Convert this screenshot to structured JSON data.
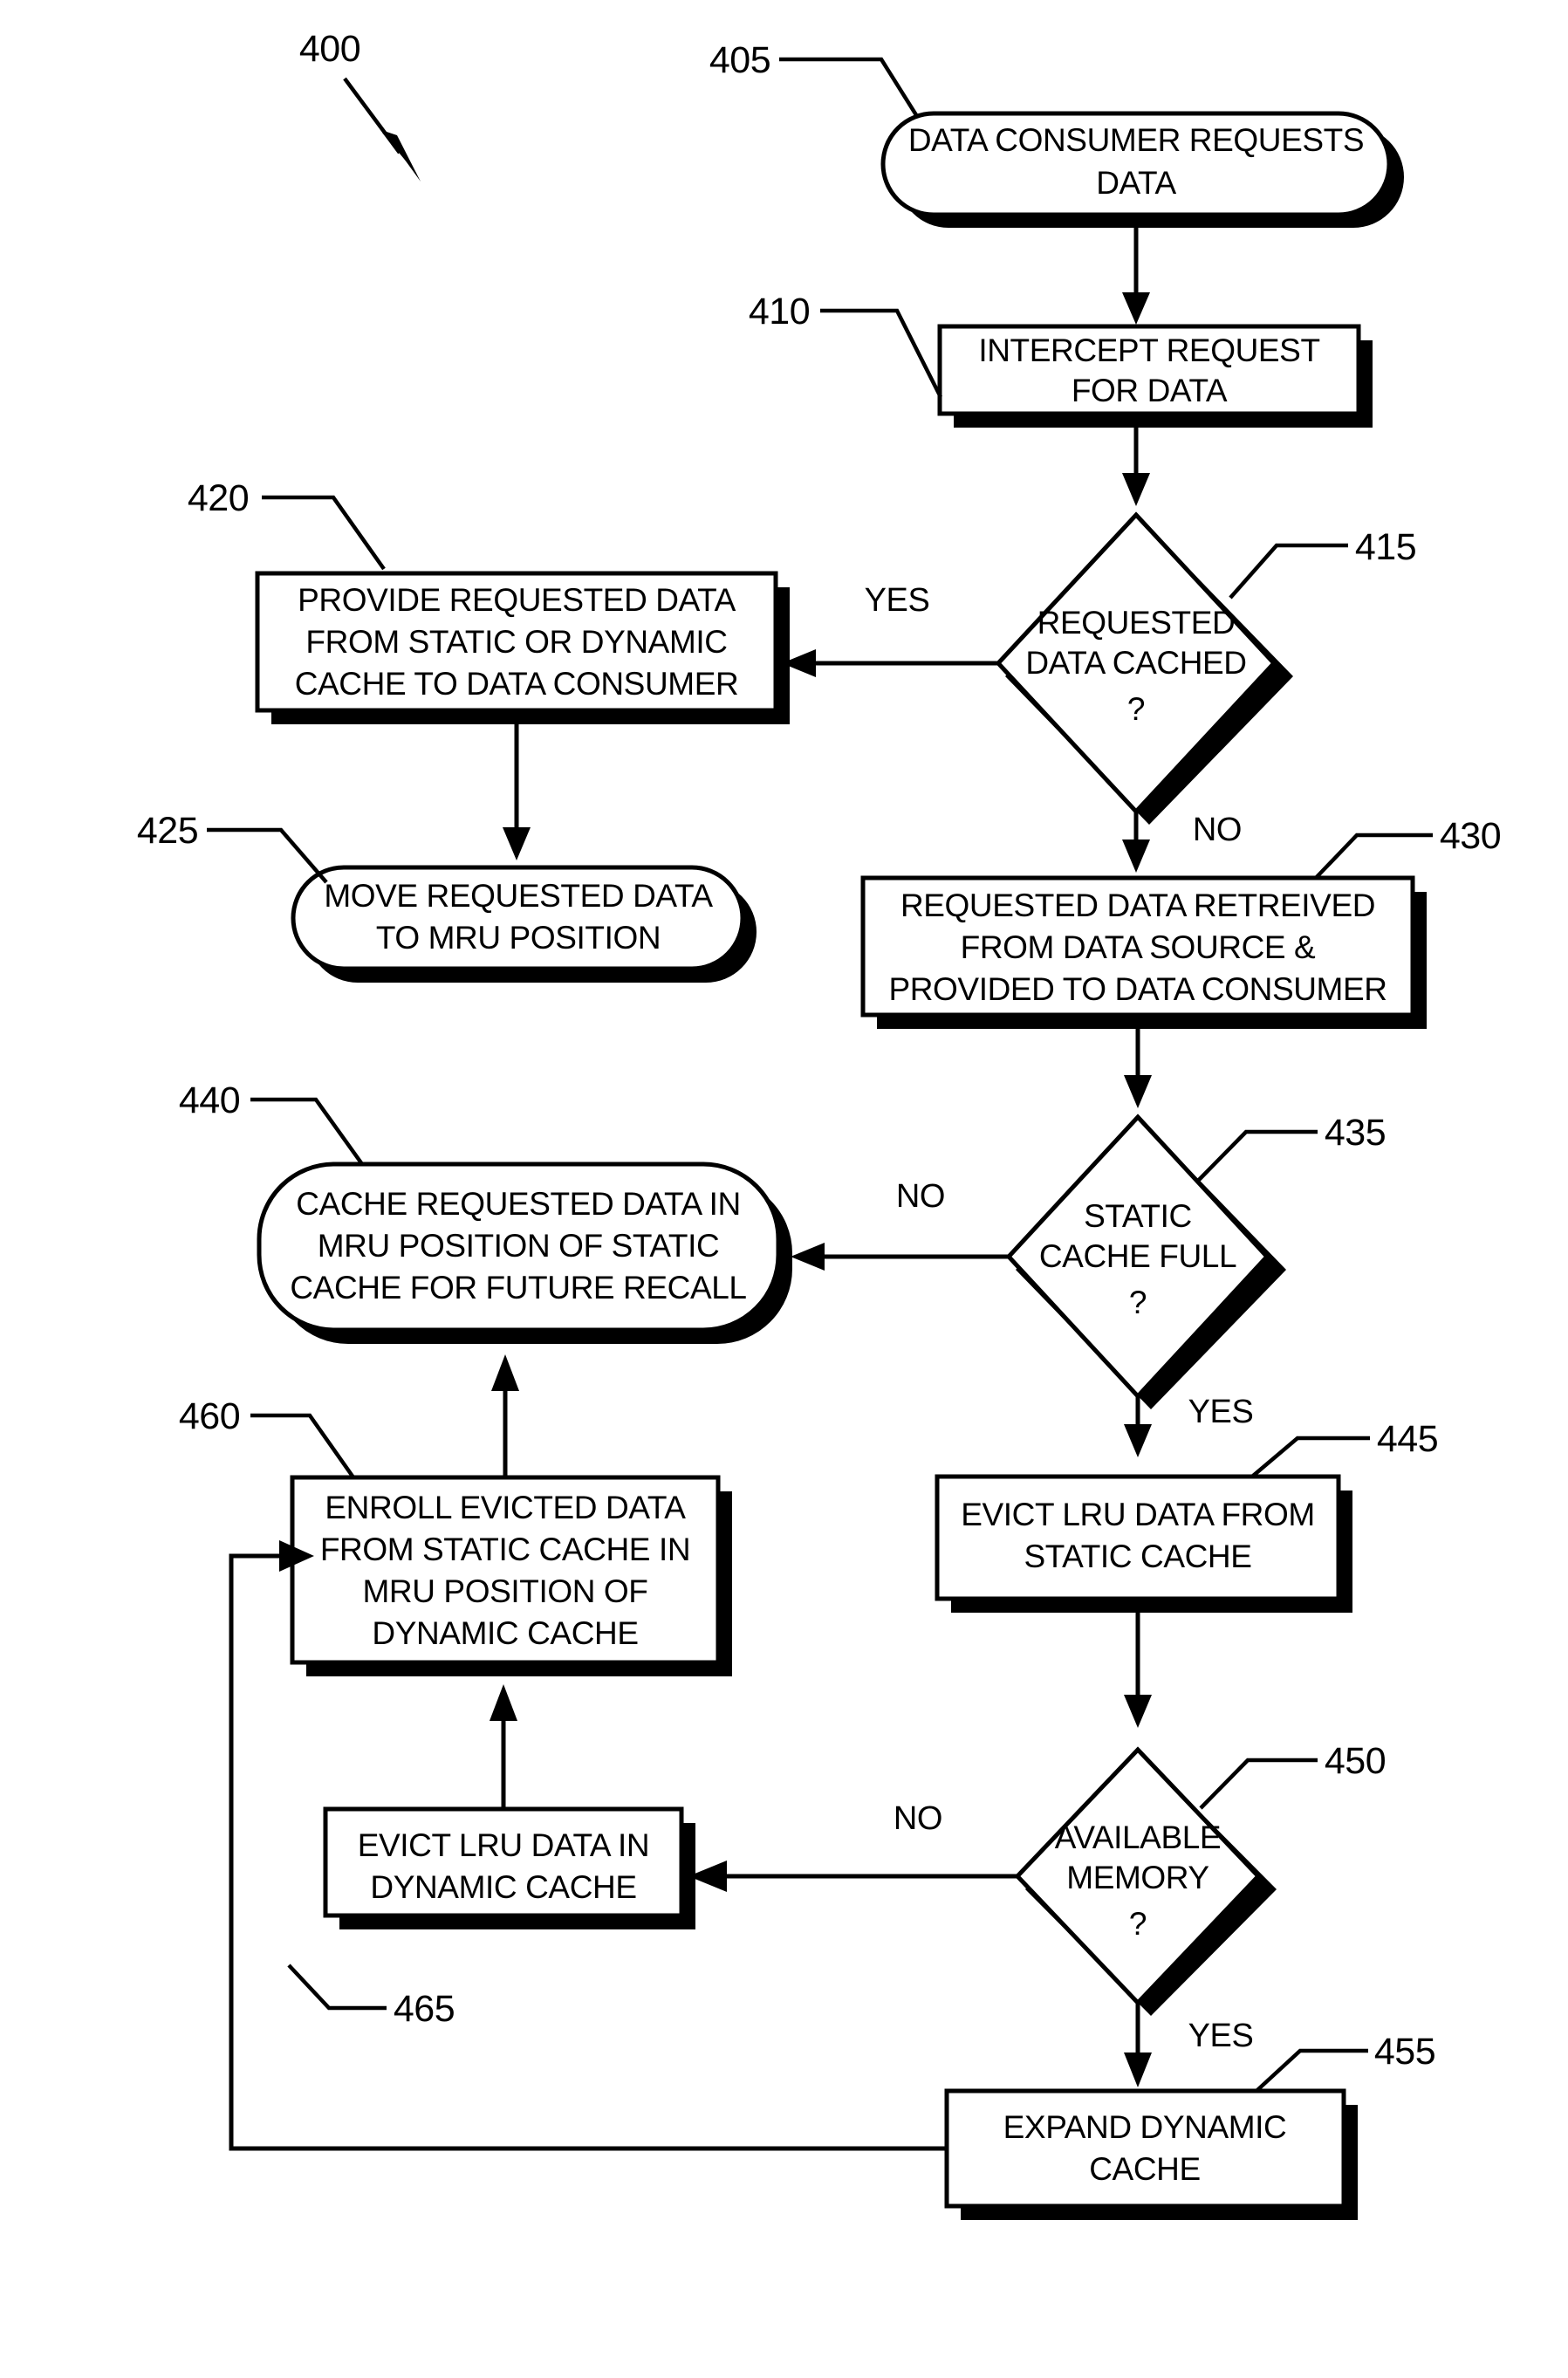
{
  "figure": {
    "reference_numeral": "400",
    "type": "patent-flowchart"
  },
  "nodes": {
    "n405": {
      "ref": "405",
      "shape": "terminator",
      "lines": [
        "DATA CONSUMER REQUESTS",
        "DATA"
      ]
    },
    "n410": {
      "ref": "410",
      "shape": "process",
      "lines": [
        "INTERCEPT REQUEST",
        "FOR DATA"
      ]
    },
    "n415": {
      "ref": "415",
      "shape": "decision",
      "lines": [
        "REQUESTED",
        "DATA CACHED",
        "?"
      ]
    },
    "n420": {
      "ref": "420",
      "shape": "process",
      "lines": [
        "PROVIDE REQUESTED DATA",
        "FROM STATIC OR DYNAMIC",
        "CACHE TO DATA CONSUMER"
      ]
    },
    "n425": {
      "ref": "425",
      "shape": "terminator",
      "lines": [
        "MOVE REQUESTED DATA",
        "TO MRU POSITION"
      ]
    },
    "n430": {
      "ref": "430",
      "shape": "process",
      "lines": [
        "REQUESTED DATA RETREIVED",
        "FROM DATA SOURCE &",
        "PROVIDED TO DATA CONSUMER"
      ]
    },
    "n435": {
      "ref": "435",
      "shape": "decision",
      "lines": [
        "STATIC",
        "CACHE FULL",
        "?"
      ]
    },
    "n440": {
      "ref": "440",
      "shape": "terminator",
      "lines": [
        "CACHE REQUESTED DATA IN",
        "MRU POSITION OF STATIC",
        "CACHE FOR FUTURE RECALL"
      ]
    },
    "n445": {
      "ref": "445",
      "shape": "process",
      "lines": [
        "EVICT LRU DATA FROM",
        "STATIC CACHE"
      ]
    },
    "n450": {
      "ref": "450",
      "shape": "decision",
      "lines": [
        "AVAILABLE",
        "MEMORY",
        "?"
      ]
    },
    "n455": {
      "ref": "455",
      "shape": "process",
      "lines": [
        "EXPAND DYNAMIC",
        "CACHE"
      ]
    },
    "n460": {
      "ref": "460",
      "shape": "process",
      "lines": [
        "ENROLL EVICTED DATA",
        "FROM STATIC CACHE IN",
        "MRU POSITION OF",
        "DYNAMIC CACHE"
      ]
    },
    "n465": {
      "ref": "465",
      "shape": "process",
      "lines": [
        "EVICT LRU DATA IN",
        "DYNAMIC CACHE"
      ]
    }
  },
  "edge_labels": {
    "e415_yes": "YES",
    "e415_no": "NO",
    "e435_no": "NO",
    "e435_yes": "YES",
    "e450_no": "NO",
    "e450_yes": "YES"
  },
  "colors": {
    "line": "#000000",
    "fill": "#ffffff",
    "shadow": "#000000"
  }
}
